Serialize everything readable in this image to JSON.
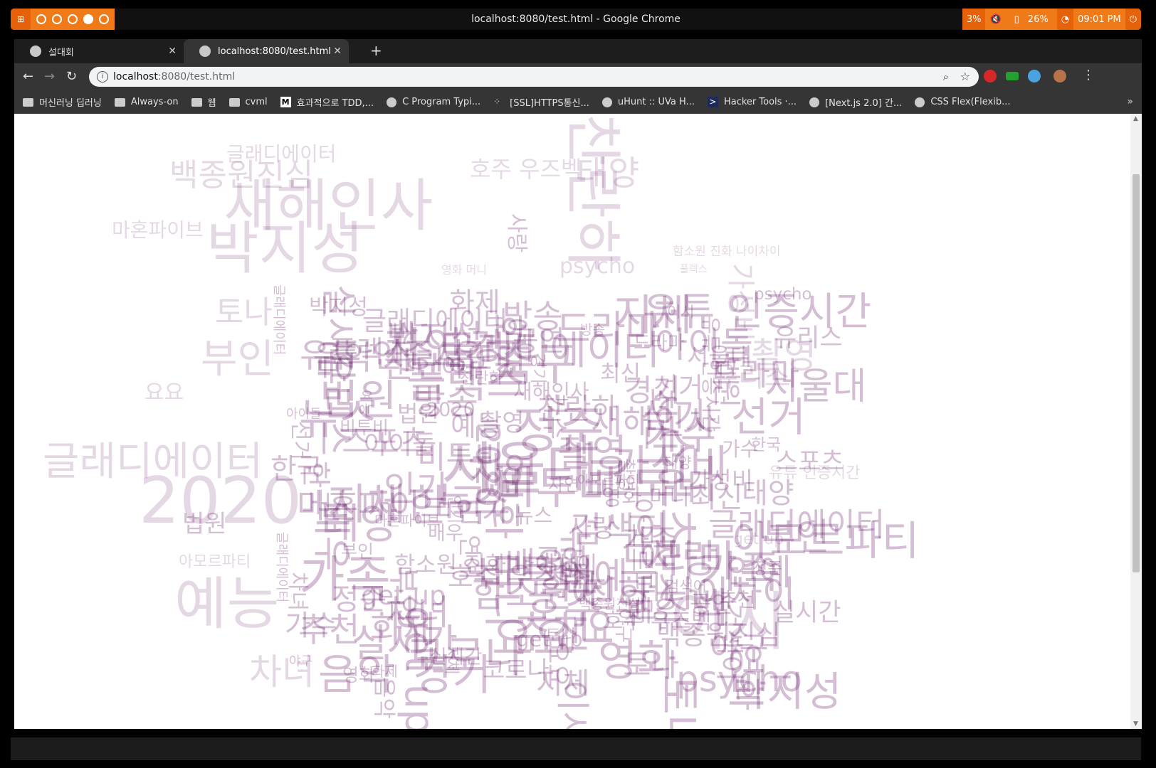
{
  "window_manager": {
    "title": "localhost:8080/test.html - Google Chrome",
    "battery_low": "3%",
    "battery": "26%",
    "clock": "09:01 PM",
    "workspace_count": 5,
    "active_workspace": 4
  },
  "tabs": [
    {
      "label": "설대회",
      "active": false
    },
    {
      "label": "localhost:8080/test.html",
      "active": true
    }
  ],
  "omnibox": {
    "host": "localhost",
    "path": ":8080/test.html"
  },
  "bookmarks": [
    {
      "label": "머신러닝 딥러닝",
      "icon": "folder-icon"
    },
    {
      "label": "Always-on",
      "icon": "folder-icon"
    },
    {
      "label": "웹",
      "icon": "folder-icon"
    },
    {
      "label": "cvml",
      "icon": "folder-icon"
    },
    {
      "label": "효과적으로 TDD,...",
      "icon": "medium-icon"
    },
    {
      "label": "C Program Typi...",
      "icon": "globe-icon"
    },
    {
      "label": "[SSL]HTTPS통신...",
      "icon": "dots-icon"
    },
    {
      "label": "uHunt :: UVa H...",
      "icon": "globe-icon"
    },
    {
      "label": "Hacker Tools ·...",
      "icon": "terminal-icon"
    },
    {
      "label": "[Next.js 2.0] 간...",
      "icon": "globe-icon"
    },
    {
      "label": "CSS Flex(Flexib...",
      "icon": "globe-icon"
    }
  ],
  "word_cloud": [
    {
      "text": "글래디에이터"
    },
    {
      "text": "백종원진심"
    },
    {
      "text": "마혼파이브"
    },
    {
      "text": "새해인사"
    },
    {
      "text": "박지성"
    },
    {
      "text": "호주 우즈벡"
    },
    {
      "text": "태양"
    },
    {
      "text": "찬란하"
    },
    {
      "text": "psycho"
    },
    {
      "text": "함소원 진화 나이차이"
    },
    {
      "text": "가성비"
    },
    {
      "text": "플렉스"
    },
    {
      "text": "토나"
    },
    {
      "text": "부인"
    },
    {
      "text": "촬영"
    },
    {
      "text": "유리스"
    },
    {
      "text": "요요"
    },
    {
      "text": "글래디에이터"
    },
    {
      "text": "2020"
    },
    {
      "text": "유튜 인증시간"
    },
    {
      "text": "get up"
    },
    {
      "text": "아모르파티"
    },
    {
      "text": "예능"
    },
    {
      "text": "이시"
    },
    {
      "text": "차녀"
    },
    {
      "text": "영화 머니"
    },
    {
      "text": "법원"
    },
    {
      "text": "지체"
    },
    {
      "text": "정준"
    },
    {
      "text": "자연"
    },
    {
      "text": "서울대"
    },
    {
      "text": "코로나"
    },
    {
      "text": "가족"
    },
    {
      "text": "비투비"
    },
    {
      "text": "드라마"
    },
    {
      "text": "실시간"
    },
    {
      "text": "사랑"
    },
    {
      "text": "아이돌"
    },
    {
      "text": "방송"
    },
    {
      "text": "추천"
    },
    {
      "text": "뉴스"
    },
    {
      "text": "선거"
    },
    {
      "text": "화제"
    },
    {
      "text": "검색어"
    },
    {
      "text": "인기"
    },
    {
      "text": "최신"
    },
    {
      "text": "음악"
    },
    {
      "text": "공연"
    },
    {
      "text": "한국"
    },
    {
      "text": "경기"
    },
    {
      "text": "영화"
    },
    {
      "text": "연예"
    },
    {
      "text": "스포츠"
    },
    {
      "text": "축구"
    },
    {
      "text": "야구"
    },
    {
      "text": "배우"
    },
    {
      "text": "가수"
    }
  ]
}
